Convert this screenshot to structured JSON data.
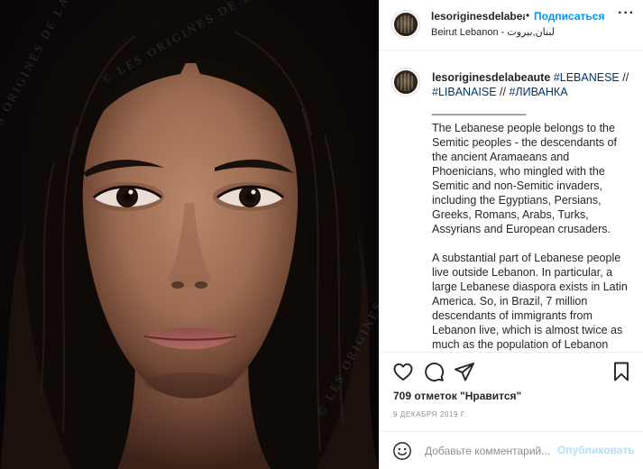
{
  "photo": {
    "watermark": "© LES ORIGINES DE LA BEAUTE",
    "subject": "portrait-photo"
  },
  "header": {
    "username": "lesoriginesdelabeaute",
    "dot": "•",
    "follow_label": "Подписаться",
    "more_label": "···",
    "location": "Beirut Lebanon - لبنان,بيروت"
  },
  "caption": {
    "username": "lesoriginesdelabeaute",
    "tags": [
      "#LEBANESE",
      "#LIBANAISE",
      "#ЛИВАНКА"
    ],
    "separator": " // ",
    "divider": "_______________",
    "paragraphs": [
      "The Lebanese people belongs to the Semitic peoples - the descendants of the ancient Aramaeans and Phoenicians, who mingled with the Semitic and non-Semitic invaders, including the Egyptians, Persians, Greeks, Romans, Arabs, Turks, Assyrians and European crusaders.",
      "A substantial part of Lebanese people live outside Lebanon. In particular, a large Lebanese diaspora exists in Latin America. So, in Brazil, 7 million descendants of immigrants from Lebanon live, which is almost twice as much as the population of Lebanon itself."
    ]
  },
  "actions": {
    "like_icon": "heart-icon",
    "comment_icon": "comment-icon",
    "share_icon": "paper-plane-icon",
    "save_icon": "bookmark-icon"
  },
  "likes_text": "709 отметок \"Нравится\"",
  "date_text": "9 ДЕКАБРЯ 2019 Г.",
  "comment": {
    "emoji_icon": "smile-icon",
    "placeholder": "Добавьте комментарий...",
    "post_label": "Опубликовать"
  },
  "colors": {
    "accent": "#0095f6",
    "hashtag": "#00376b",
    "text": "#262626",
    "muted": "#8e8e8e",
    "border": "#efefef",
    "post_disabled": "#b2dffc"
  }
}
